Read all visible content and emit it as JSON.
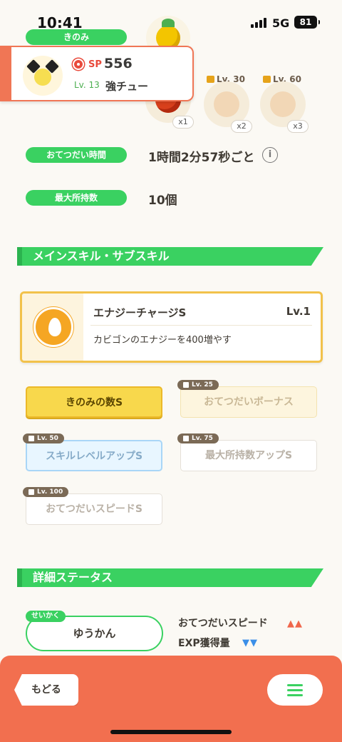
{
  "status_bar": {
    "time": "10:41",
    "network": "5G",
    "battery": "81"
  },
  "berry_section": {
    "label": "きのみ"
  },
  "ingredients": {
    "items": [
      {
        "multiplier": "x1"
      },
      {
        "multiplier": "x2",
        "unlock_level": "Lv. 30"
      },
      {
        "multiplier": "x3",
        "unlock_level": "Lv. 60"
      }
    ]
  },
  "pokemon_card": {
    "sp_label": "SP",
    "sp_value": "556",
    "level": "Lv. 13",
    "nickname": "強チュー"
  },
  "help_time": {
    "label": "おてつだい時間",
    "value": "1時間2分57秒ごと",
    "info_icon": "i"
  },
  "max_carry": {
    "label": "最大所持数",
    "value": "10個"
  },
  "skills_section": {
    "title": "メインスキル・サブスキル"
  },
  "main_skill": {
    "name": "エナジーチャージS",
    "level": "Lv.1",
    "description": "カビゴンのエナジーを400増やす"
  },
  "sub_skills": [
    {
      "label": "きのみの数S",
      "unlock_level": ""
    },
    {
      "label": "おてつだいボーナス",
      "unlock_level": "Lv. 25"
    },
    {
      "label": "スキルレベルアップS",
      "unlock_level": "Lv. 50"
    },
    {
      "label": "最大所持数アップS",
      "unlock_level": "Lv. 75"
    },
    {
      "label": "おてつだいスピードS",
      "unlock_level": "Lv. 100"
    }
  ],
  "details_section": {
    "title": "詳細ステータス"
  },
  "nature": {
    "tag": "せいかく",
    "value": "ゆうかん",
    "up_label": "おてつだいスピード",
    "up_arrows": "▲▲",
    "down_label": "EXP獲得量",
    "down_arrows": "▼▼"
  },
  "bottom_bar": {
    "back_label": "もどる"
  },
  "colors": {
    "green": "#3ad161",
    "orange": "#f26f4f",
    "yellow": "#f8d84c"
  }
}
